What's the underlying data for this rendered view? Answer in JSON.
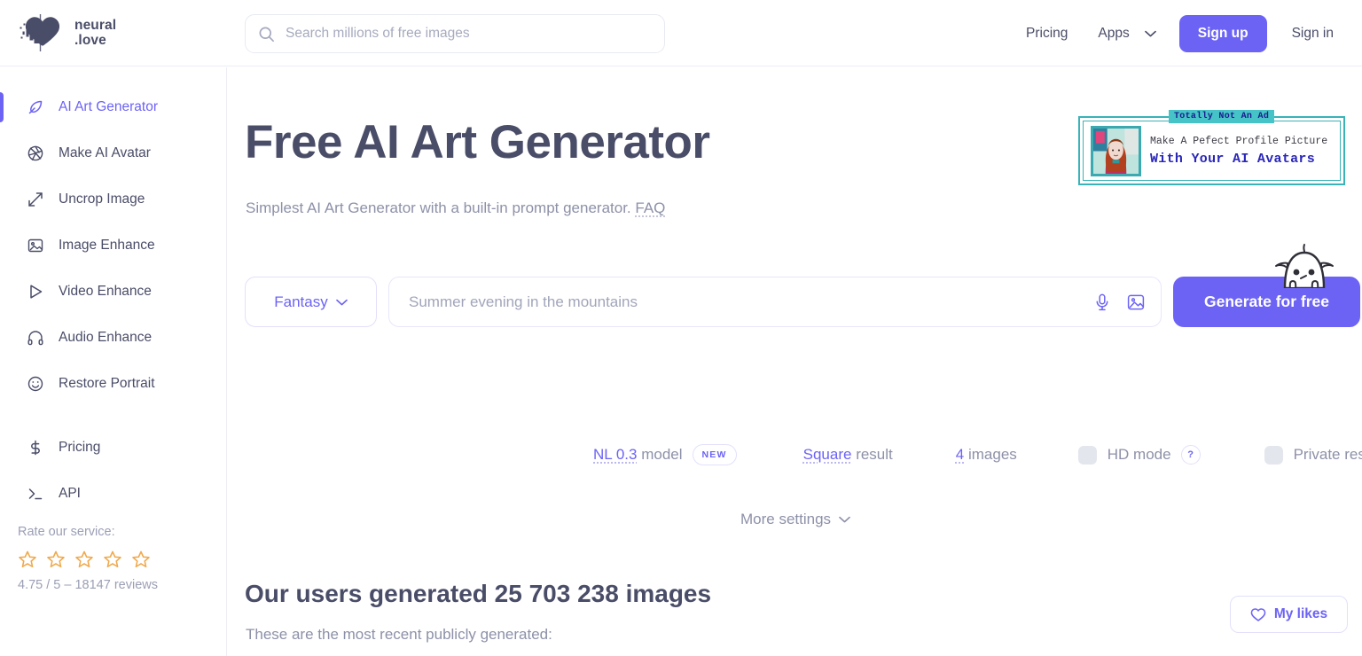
{
  "brand": {
    "name": "neural\n.love",
    "logo_icon": "heart-logo-icon"
  },
  "search": {
    "placeholder": "Search millions of free images",
    "value": "",
    "icon": "search-icon"
  },
  "header": {
    "pricing_label": "Pricing",
    "apps_label": "Apps",
    "apps_chevron_icon": "chevron-down-icon",
    "signup_label": "Sign up",
    "signin_label": "Sign in",
    "signup_color": "#6c63f5"
  },
  "sidebar": {
    "items": [
      {
        "label": "AI Art Generator",
        "icon": "feather-pen-icon",
        "active": true
      },
      {
        "label": "Make AI Avatar",
        "icon": "aperture-icon",
        "active": false
      },
      {
        "label": "Uncrop Image",
        "icon": "expand-arrows-icon",
        "active": false
      },
      {
        "label": "Image Enhance",
        "icon": "image-icon",
        "active": false
      },
      {
        "label": "Video Enhance",
        "icon": "play-triangle-icon",
        "active": false
      },
      {
        "label": "Audio Enhance",
        "icon": "headphones-icon",
        "active": false
      },
      {
        "label": "Restore Portrait",
        "icon": "smiley-face-icon",
        "active": false
      }
    ],
    "secondary": [
      {
        "label": "Pricing",
        "icon": "dollar-sign-icon"
      },
      {
        "label": "API",
        "icon": "terminal-prompt-icon"
      }
    ],
    "rating": {
      "label": "Rate our service:",
      "stars": 5,
      "star_color": "#f0a94c",
      "summary": "4.75 / 5 – 18147 reviews"
    }
  },
  "main": {
    "title": "Free AI Art Generator",
    "subtitle_text": "Simplest AI Art Generator with a built-in prompt generator.",
    "subtitle_link": "FAQ"
  },
  "ad": {
    "badge": "Totally Not An Ad",
    "line1": "Make A Pefect Profile Picture",
    "line2": "With Your AI Avatars",
    "border_color": "#39b3b8",
    "headline_color": "#2a27b8",
    "thumb_icon": "avatar-portrait-thumbnail"
  },
  "prompt": {
    "style_label": "Fantasy",
    "style_chevron_icon": "chevron-down-icon",
    "placeholder": "Summer evening in the mountains",
    "value": "",
    "mic_icon": "microphone-icon",
    "image_icon": "image-upload-icon",
    "generate_label": "Generate for free",
    "mascot_icon": "mascot-ghost-icon"
  },
  "options": {
    "model_link": "NL 0.3",
    "model_suffix": "model",
    "model_badge": "NEW",
    "ratio_link": "Square",
    "ratio_suffix": "result",
    "count_link": "4",
    "count_suffix": "images",
    "hd_label": "HD mode",
    "hd_checked": false,
    "private_label": "Private results",
    "private_checked": false,
    "help_glyph": "?",
    "more_settings_label": "More settings",
    "more_settings_chevron_icon": "chevron-down-icon"
  },
  "bottom": {
    "heading": "Our users generated 25 703 238 images",
    "note": "These are the most recent publicly generated:",
    "likes_label": "My likes",
    "likes_icon": "heart-outline-icon"
  }
}
